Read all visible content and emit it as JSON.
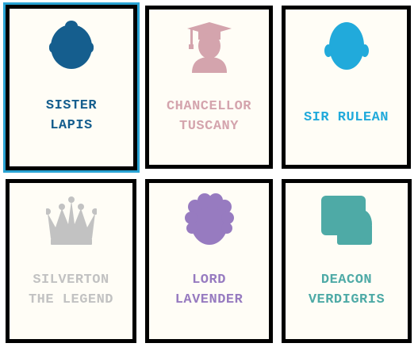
{
  "cards": [
    {
      "line1": "SISTER",
      "line2": "LAPIS",
      "icon": "nun-head-icon",
      "color": "#155e8e",
      "selected": true
    },
    {
      "line1": "CHANCELLOR",
      "line2": "TUSCANY",
      "icon": "graduate-cap-icon",
      "color": "#d4a4ad",
      "selected": false
    },
    {
      "line1": "SIR RULEAN",
      "line2": "",
      "icon": "knight-head-icon",
      "color": "#21aadb",
      "selected": false
    },
    {
      "line1": "SILVERTON",
      "line2": "THE LEGEND",
      "icon": "crown-icon",
      "color": "#c2c2c2",
      "selected": false
    },
    {
      "line1": "LORD",
      "line2": "LAVENDER",
      "icon": "curly-wig-icon",
      "color": "#977bc0",
      "selected": false
    },
    {
      "line1": "DEACON",
      "line2": "VERDIGRIS",
      "icon": "blocky-head-icon",
      "color": "#4eaaa6",
      "selected": false
    }
  ]
}
